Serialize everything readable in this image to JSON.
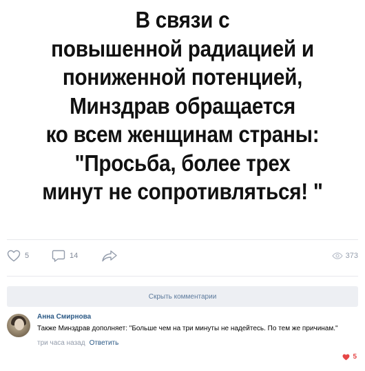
{
  "post": {
    "image_text_lines": [
      "В связи с",
      "повышенной радиацией и",
      "пониженной потенцией,",
      "Минздрав обращается",
      "ко всем женщинам страны:",
      "\"Просьба, более трех",
      "минут не сопротивляться! \""
    ]
  },
  "actions": {
    "likes": "5",
    "comments": "14",
    "views": "373"
  },
  "comments_section": {
    "hide_label": "Скрыть комментарии"
  },
  "comment": {
    "author": "Анна Смирнова",
    "text": "Также Минздрав дополняет: \"Больше чем на три минуты не надейтесь. По тем же причинам.\"",
    "time": "три часа назад",
    "reply_label": "Ответить",
    "likes": "5"
  },
  "colors": {
    "link": "#2a5885",
    "muted": "#828a99",
    "like_active": "#e64646",
    "button_bg": "#edeff3"
  }
}
